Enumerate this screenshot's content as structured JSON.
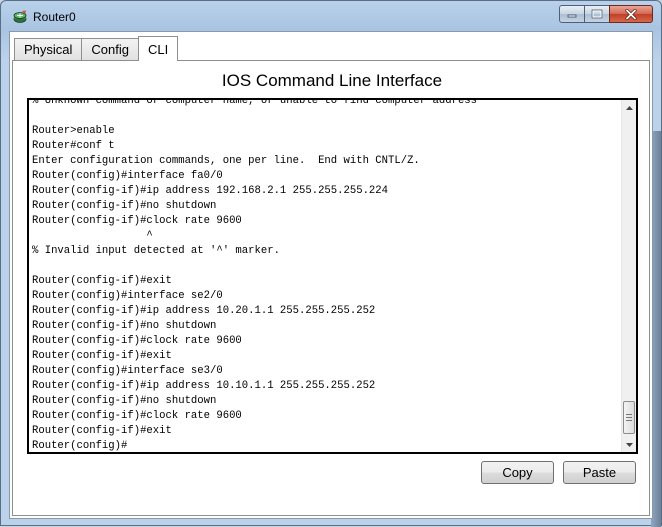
{
  "window": {
    "title": "Router0",
    "icon": "router-icon",
    "controls": [
      "minimize-icon",
      "maximize-icon",
      "close-icon"
    ]
  },
  "tabs": [
    {
      "label": "Physical",
      "active": false
    },
    {
      "label": "Config",
      "active": false
    },
    {
      "label": "CLI",
      "active": true
    }
  ],
  "cli": {
    "heading": "IOS Command Line Interface",
    "lines": [
      "% Unknown command or computer name, or unable to find computer address",
      "",
      "Router>enable",
      "Router#conf t",
      "Enter configuration commands, one per line.  End with CNTL/Z.",
      "Router(config)#interface fa0/0",
      "Router(config-if)#ip address 192.168.2.1 255.255.255.224",
      "Router(config-if)#no shutdown",
      "Router(config-if)#clock rate 9600",
      "                  ^",
      "% Invalid input detected at '^' marker.",
      "",
      "Router(config-if)#exit",
      "Router(config)#interface se2/0",
      "Router(config-if)#ip address 10.20.1.1 255.255.255.252",
      "Router(config-if)#no shutdown",
      "Router(config-if)#clock rate 9600",
      "Router(config-if)#exit",
      "Router(config)#interface se3/0",
      "Router(config-if)#ip address 10.10.1.1 255.255.255.252",
      "Router(config-if)#no shutdown",
      "Router(config-if)#clock rate 9600",
      "Router(config-if)#exit",
      "Router(config)#"
    ]
  },
  "buttons": {
    "copy": "Copy",
    "paste": "Paste"
  }
}
